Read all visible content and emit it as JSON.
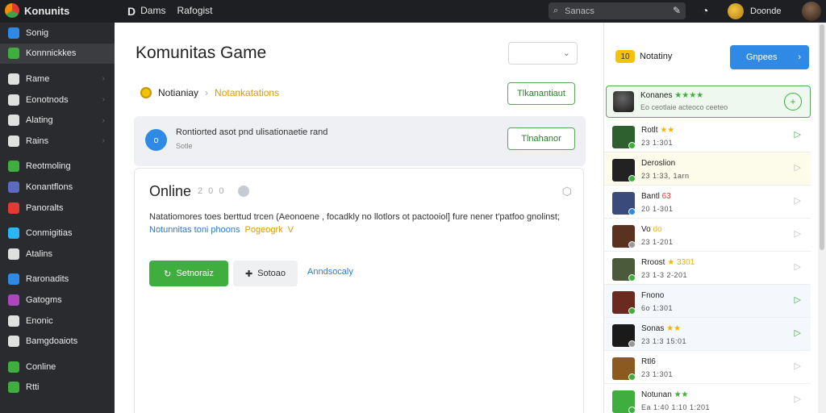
{
  "topbar": {
    "brand": "Konunits",
    "nav_d": "D",
    "nav_items": [
      "Dams",
      "Rafogist"
    ],
    "search_placeholder": "Sanacs",
    "user_name": "Doonde"
  },
  "sidebar": {
    "items": [
      {
        "label": "Sonig",
        "color": "#2f8ae6"
      },
      {
        "label": "Konnnickkes",
        "color": "#3fae3f"
      },
      {
        "label": "Rame",
        "color": "#e0e0e0"
      },
      {
        "label": "Eonotnods",
        "color": "#e0e0e0"
      },
      {
        "label": "Alating",
        "color": "#e0e0e0"
      },
      {
        "label": "Rains",
        "color": "#e0e0e0"
      },
      {
        "label": "Reotmoling",
        "color": "#3fae3f"
      },
      {
        "label": "Konantflons",
        "color": "#5c6bc0"
      },
      {
        "label": "Panoralts",
        "color": "#e53935"
      },
      {
        "label": "Conmigitias",
        "color": "#29b6f6"
      },
      {
        "label": "Atalins",
        "color": "#e0e0e0"
      },
      {
        "label": "Raronadits",
        "color": "#2f8ae6"
      },
      {
        "label": "Gatogms",
        "color": "#ab47bc"
      },
      {
        "label": "Enonic",
        "color": "#e0e0e0"
      },
      {
        "label": "Bamgdoaiots",
        "color": "#e0e0e0"
      },
      {
        "label": "Conline",
        "color": "#3fae3f"
      },
      {
        "label": "Rtti",
        "color": "#3fae3f"
      }
    ]
  },
  "main": {
    "title": "Komunitas Game",
    "breadcrumb": {
      "first": "Notianiay",
      "second": "Notankatations"
    },
    "outline_btn_1": "Tlkanantiaut",
    "outline_btn_2": "Tlnahanor",
    "notice": {
      "line1": "Rontiorted asot pnd ulisationaetie rand",
      "line2": "Sotle",
      "icon": "o"
    },
    "card": {
      "title": "Online",
      "meta": "2 0 0",
      "description": "Natatiomores toes berttud trcen (Aeonoene , focadkly no llotlors ot pactooiol] fure nener t'patfoo gnolinst;",
      "link_blue": "Notunnitas toni phoons",
      "link_orange": "Pogeogrk",
      "link_orange_icon": "V",
      "btn_primary": "Setnoraiz",
      "btn_secondary": "Sotoao",
      "btn_link": "Anndsocaly"
    }
  },
  "right": {
    "notif_badge": "10",
    "notif_label": "Notatiny",
    "blue_btn": "Gnpees",
    "featured": {
      "name": "Konanes",
      "stars": "★★★★",
      "sub": "Eo ceotlaie acteoco ceeteo"
    },
    "games": [
      {
        "name": "Rotlt",
        "stars": "★★",
        "star_class": "",
        "meta": "23  1:301",
        "thumb": "#2e5f2e",
        "dot": "green",
        "arrow": "▷",
        "arrow_green": true,
        "hl": ""
      },
      {
        "name": "Deroslion",
        "stars": "",
        "star_class": "",
        "meta": "23  1:33, 1arn",
        "thumb": "#222",
        "dot": "green",
        "arrow": "▷",
        "arrow_green": false,
        "hl": "hl2"
      },
      {
        "name": "Bantl",
        "stars": "63",
        "star_class": "r",
        "meta": "20  1-301",
        "thumb": "#3a4a7a",
        "dot": "blue",
        "arrow": "▷",
        "arrow_green": false,
        "hl": ""
      },
      {
        "name": "Vo",
        "stars": "do",
        "star_class": "",
        "meta": "23  1-201",
        "thumb": "#5a3320",
        "dot": "gray",
        "arrow": "▷",
        "arrow_green": false,
        "hl": ""
      },
      {
        "name": "Rroost",
        "stars": "★ 3301",
        "star_class": "",
        "meta": "23  1-3 2-201",
        "thumb": "#4a5a3a",
        "dot": "green",
        "arrow": "▷",
        "arrow_green": false,
        "hl": ""
      },
      {
        "name": "Fnono",
        "stars": "",
        "star_class": "",
        "meta": "6o  1:301",
        "thumb": "#6a2a20",
        "dot": "green",
        "arrow": "▷",
        "arrow_green": true,
        "hl": "hl"
      },
      {
        "name": "Sonas",
        "stars": "★★",
        "star_class": "",
        "meta": "23  1:3  15:01",
        "thumb": "#1a1a1a",
        "dot": "gray",
        "arrow": "▷",
        "arrow_green": true,
        "hl": "hl"
      },
      {
        "name": "Rtl6",
        "stars": "",
        "star_class": "",
        "meta": "23  1:301",
        "thumb": "#8a5a20",
        "dot": "green",
        "arrow": "▷",
        "arrow_green": false,
        "hl": ""
      },
      {
        "name": "Notunan",
        "stars": "★★",
        "star_class": "g",
        "meta": "Ea 1:40 1:10 1:201",
        "thumb": "#3fae3f",
        "dot": "green",
        "arrow": "▷",
        "arrow_green": false,
        "hl": ""
      }
    ]
  }
}
